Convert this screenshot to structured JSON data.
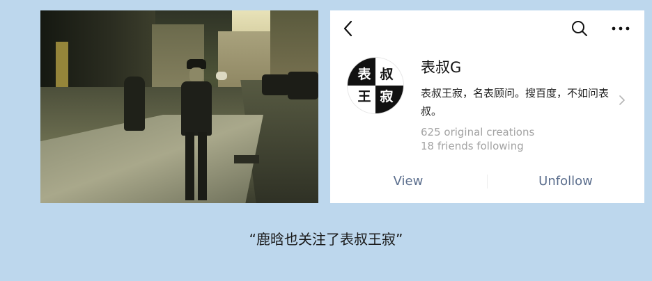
{
  "profile": {
    "avatar_chars": [
      "表",
      "叔",
      "王",
      "寂"
    ],
    "name": "表叔G",
    "bio": "表叔王寂，名表顾问。搜百度，不如问表叔。",
    "original_creations": "625 original creations",
    "friends_following": "18 friends following"
  },
  "actions": {
    "view": "View",
    "unfollow": "Unfollow"
  },
  "icons": {
    "back": "back-arrow-icon",
    "search": "search-icon",
    "more": "more-dots-icon",
    "chevron": "chevron-right-icon"
  },
  "caption": "“鹿晗也关注了表叔王寂”",
  "colors": {
    "background": "#bdd7ed",
    "action_text": "#5b6e8d",
    "stat_text": "#a3a3a3"
  }
}
